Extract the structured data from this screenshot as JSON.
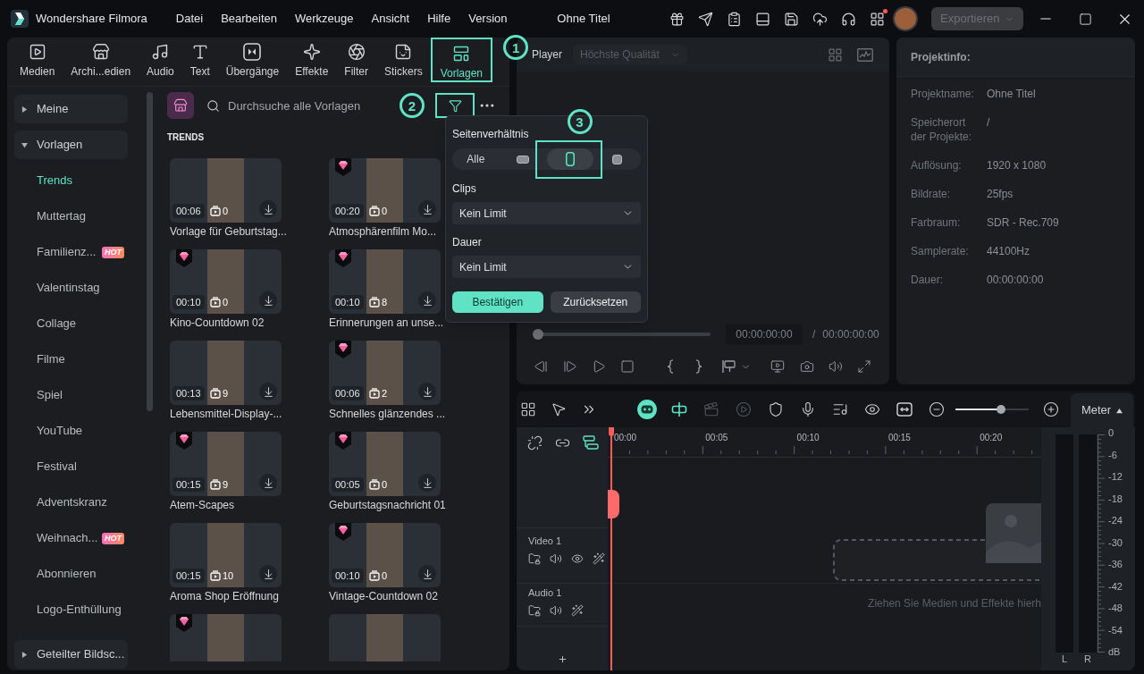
{
  "titlebar": {
    "app_name": "Wondershare Filmora",
    "menu": [
      "Datei",
      "Bearbeiten",
      "Werkzeuge",
      "Ansicht",
      "Hilfe",
      "Version"
    ],
    "project_title": "Ohne Titel",
    "apps_badge": true,
    "export_button": {
      "label": "Exportieren",
      "disabled": true
    }
  },
  "media_tabs": [
    {
      "label": "Medien",
      "selected": false
    },
    {
      "label": "Archi...edien",
      "selected": false
    },
    {
      "label": "Audio",
      "selected": false
    },
    {
      "label": "Text",
      "selected": false
    },
    {
      "label": "Übergänge",
      "selected": false
    },
    {
      "label": "Effekte",
      "selected": false
    },
    {
      "label": "Filter",
      "selected": false
    },
    {
      "label": "Stickers",
      "selected": false
    },
    {
      "label": "Vorlagen",
      "selected": true,
      "callout": "1"
    }
  ],
  "sidebar": [
    {
      "label": "Meine",
      "expanded": false
    },
    {
      "label": "Vorlagen",
      "expanded": true,
      "children": [
        {
          "label": "Trends",
          "selected": true
        },
        {
          "label": "Muttertag",
          "selected": false
        },
        {
          "label": "Familienz...",
          "selected": false,
          "badge": "HOT"
        },
        {
          "label": "Valentinstag",
          "selected": false
        },
        {
          "label": "Collage",
          "selected": false
        },
        {
          "label": "Filme",
          "selected": false
        },
        {
          "label": "Spiel",
          "selected": false
        },
        {
          "label": "YouTube",
          "selected": false
        },
        {
          "label": "Festival",
          "selected": false
        },
        {
          "label": "Adventskranz",
          "selected": false
        },
        {
          "label": "Weihnach...",
          "selected": false,
          "badge": "HOT"
        },
        {
          "label": "Abonnieren",
          "selected": false
        },
        {
          "label": "Logo-Enthüllung",
          "selected": false
        }
      ]
    },
    {
      "label": "Geteilter Bildsc...",
      "expanded": false
    }
  ],
  "search": {
    "placeholder": "Durchsuche alle Vorlagen"
  },
  "filter_button": {
    "active": true,
    "callout": "2"
  },
  "section_title": "TRENDS",
  "templates": [
    {
      "title": "Vorlage für Geburtstag...",
      "duration": "00:06",
      "clips": "0",
      "premium": false
    },
    {
      "title": "Atmosphärenfilm Mo...",
      "duration": "00:20",
      "clips": "0",
      "premium": true
    },
    {
      "title": "Kino-Countdown 02",
      "duration": "00:10",
      "clips": "0",
      "premium": true
    },
    {
      "title": "Erinnerungen an unse...",
      "duration": "00:10",
      "clips": "8",
      "premium": true
    },
    {
      "title": "Lebensmittel-Display-...",
      "duration": "00:13",
      "clips": "9",
      "premium": false
    },
    {
      "title": "Schnelles glänzendes ...",
      "duration": "00:06",
      "clips": "2",
      "premium": true
    },
    {
      "title": "Atem-Scapes",
      "duration": "00:15",
      "clips": "9",
      "premium": true
    },
    {
      "title": "Geburtstagsnachricht 01",
      "duration": "00:05",
      "clips": "0",
      "premium": true
    },
    {
      "title": "Aroma Shop Eröffnung",
      "duration": "00:15",
      "clips": "10",
      "premium": false
    },
    {
      "title": "Vintage-Countdown 02",
      "duration": "00:10",
      "clips": "0",
      "premium": true
    },
    {
      "premium": true
    },
    {
      "premium": false
    }
  ],
  "filter_popup": {
    "aspect_label": "Seitenverhältnis",
    "aspect_options": [
      {
        "kind": "all",
        "label": "Alle",
        "selected": false
      },
      {
        "kind": "landscape",
        "selected": false
      },
      {
        "kind": "portrait",
        "selected": true,
        "callout": "3"
      },
      {
        "kind": "square",
        "selected": false
      }
    ],
    "clips_label": "Clips",
    "clips_value": "Kein Limit",
    "duration_label": "Dauer",
    "duration_value": "Kein Limit",
    "buttons": [
      {
        "label": "Bestätigen",
        "kind": "primary"
      },
      {
        "label": "Zurücksetzen",
        "kind": "secondary"
      }
    ]
  },
  "player": {
    "label": "Player",
    "quality": {
      "value": "Höchste Qualität",
      "disabled": true
    },
    "progress": {
      "level": 0
    },
    "current_time": "00:00:00:00",
    "separator": "/",
    "total_time": "00:00:00:00"
  },
  "project_info": {
    "title": "Projektinfo:",
    "rows": [
      {
        "label": "Projektname:",
        "value": "Ohne Titel"
      },
      {
        "label": "Speicherort der Projekte:",
        "value": "/"
      },
      {
        "label": "Auflösung:",
        "value": "1920 x 1080"
      },
      {
        "label": "Bildrate:",
        "value": "25fps"
      },
      {
        "label": "Farbraum:",
        "value": "SDR - Rec.709"
      },
      {
        "label": "Samplerate:",
        "value": "44100Hz"
      },
      {
        "label": "Dauer:",
        "value": "00:00:00:00"
      }
    ]
  },
  "timeline": {
    "tools": [
      {
        "active": true,
        "disabled": false
      },
      {
        "active": true,
        "disabled": false
      },
      {
        "active": false,
        "disabled": true
      },
      {
        "active": false,
        "disabled": true
      },
      {
        "active": false,
        "disabled": false
      },
      {
        "active": false,
        "disabled": false
      },
      {
        "active": false,
        "disabled": false
      },
      {
        "active": false,
        "disabled": false
      },
      {
        "active": false,
        "disabled": false
      }
    ],
    "zoom": {
      "level": 0.62
    },
    "meter_tab": {
      "label": "Meter",
      "expanded": true
    },
    "track_tools": [
      {
        "active": false
      },
      {
        "active": false
      },
      {
        "active": true
      }
    ],
    "ruler": [
      "00:00",
      "00:05",
      "00:10",
      "00:15",
      "00:20"
    ],
    "tracks": [
      {
        "kind": "video",
        "name": "Video 1"
      },
      {
        "kind": "audio",
        "name": "Audio 1"
      }
    ],
    "drop_hint": "Ziehen Sie Medien und Effekte hierh",
    "meter_scale": [
      "0",
      "-6",
      "-12",
      "-18",
      "-24",
      "-30",
      "-36",
      "-42",
      "-48",
      "-54",
      "dB"
    ],
    "channels": [
      "L",
      "R"
    ]
  }
}
